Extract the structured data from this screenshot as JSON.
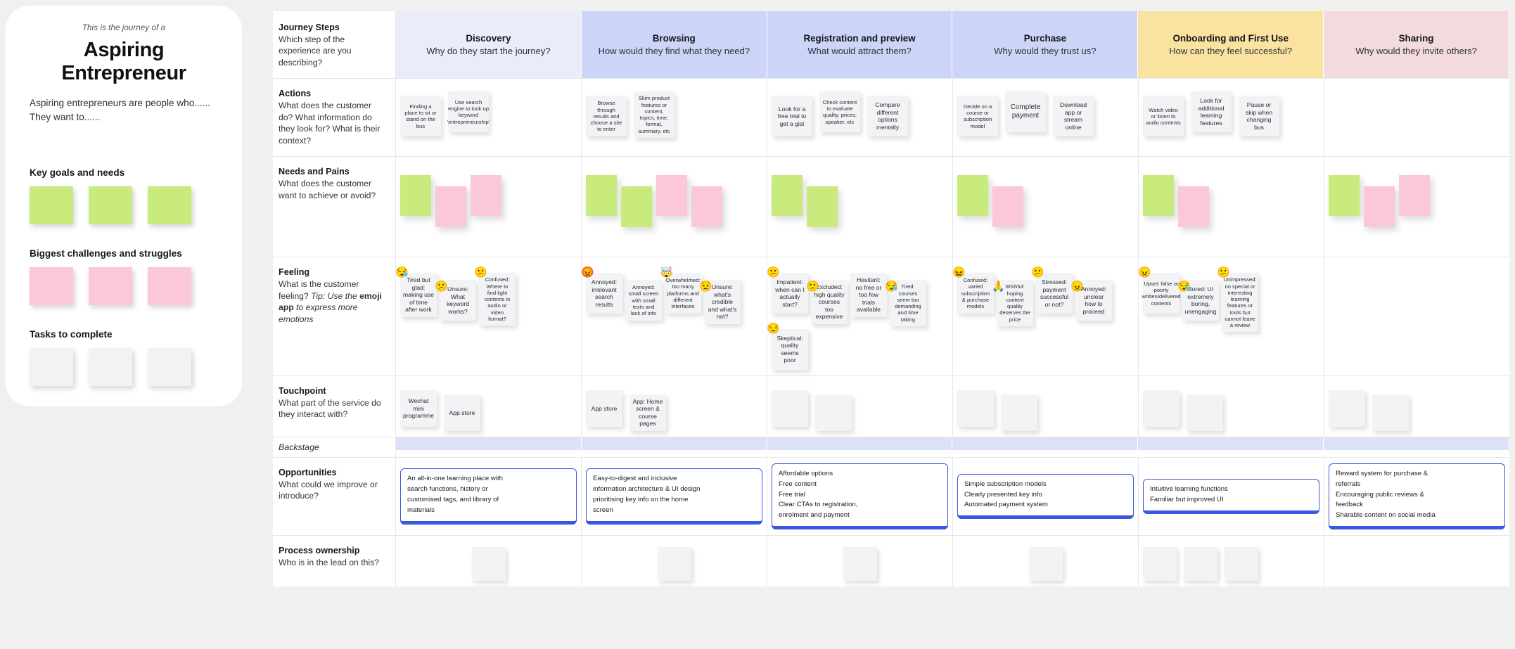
{
  "persona": {
    "kicker": "This is the journey of a",
    "title": "Aspiring Entrepreneur",
    "description": "Aspiring entrepreneurs are people who...... They want to......",
    "sections": [
      {
        "label": "Key goals and needs",
        "color": "green",
        "count": 3
      },
      {
        "label": "Biggest challenges and struggles",
        "color": "pink",
        "count": 3
      },
      {
        "label": "Tasks to complete",
        "color": "grey",
        "count": 3
      }
    ]
  },
  "rows": {
    "journey_steps": {
      "title": "Journey Steps",
      "desc": "Which step of the experience are you describing?"
    },
    "actions": {
      "title": "Actions",
      "desc": "What does the customer do? What information do they look for? What is their context?"
    },
    "needs": {
      "title": "Needs and Pains",
      "desc": "What does the customer want to achieve or avoid?"
    },
    "feeling": {
      "title": "Feeling",
      "desc_a": "What is the customer feeling? ",
      "tip_italic": "Tip: Use the ",
      "tip_bold": "emoji app",
      "tip_tail": " to express more emotions"
    },
    "touchpoint": {
      "title": "Touchpoint",
      "desc": "What part of the service do they interact with?"
    },
    "backstage": {
      "title": "Backstage"
    },
    "opportunities": {
      "title": "Opportunities",
      "desc": "What could we improve or introduce?"
    },
    "ownership": {
      "title": "Process ownership",
      "desc": "Who is in the lead on this?"
    }
  },
  "columns": [
    {
      "name": "Discovery",
      "question": "Why do they start the journey?",
      "color": "#eaecfa"
    },
    {
      "name": "Browsing",
      "question": "How would they find what they need?",
      "color": "#ccd4f7"
    },
    {
      "name": "Registration and preview",
      "question": "What would attract them?",
      "color": "#ccd4f7"
    },
    {
      "name": "Purchase",
      "question": "Why would they trust us?",
      "color": "#ccd4f7"
    },
    {
      "name": "Onboarding and First Use",
      "question": "How can they feel successful?",
      "color": "#fae2a0"
    },
    {
      "name": "Sharing",
      "question": "Why would they invite others?",
      "color": "#f3dade"
    }
  ],
  "actions": [
    [
      "Finding a place to sit or stand on the bus",
      "Use search engine to look up keyword 'entrepreneurship'"
    ],
    [
      "Browse through results and choose a site to enter",
      "Skim product features or content, topics, time, format, summary, etc"
    ],
    [
      "Look for a free trial to get a gist",
      "Check content to evaluate quality, prices, speaker, etc",
      "Compare different options mentally"
    ],
    [
      "Decide on a course or subscription model",
      "Complete payment",
      "Download app or stream online"
    ],
    [
      "Watch video or listen to audio contents",
      "Look for additional learning features",
      "Pause or skip when changing bus"
    ],
    []
  ],
  "needs": [
    [
      "green",
      "pink",
      "pink"
    ],
    [
      "green",
      "green",
      "pink",
      "pink"
    ],
    [
      "green",
      "green"
    ],
    [
      "green",
      "pink"
    ],
    [
      "green",
      "pink"
    ],
    [
      "green",
      "pink",
      "pink"
    ]
  ],
  "feelings": [
    [
      {
        "emoji": "😪",
        "text": "Tired but glad: making use of time after work"
      },
      {
        "emoji": "😕",
        "text": "Unsure: What keyword works?"
      },
      {
        "emoji": "😕",
        "text": "Confused: Where to find light contents in audio or video format?"
      }
    ],
    [
      {
        "emoji": "😡",
        "text": "Annoyed: irrelevant search results"
      },
      {
        "emoji": "",
        "text": "Annoyed: small screen with small texts and lack of info"
      },
      {
        "emoji": "🤯",
        "text": "Overwhelmed: too many platforms and different interfaces"
      },
      {
        "emoji": "😟",
        "text": "Unsure: what's credible and what's not?"
      }
    ],
    [
      {
        "emoji": "😕",
        "text": "Impatient: when can I actually start?"
      },
      {
        "emoji": "🙁",
        "text": "Excluded: high quality courses too expensive"
      },
      {
        "emoji": "",
        "text": "Hesitant: no free or too few trials available"
      },
      {
        "emoji": "😪",
        "text": "Tired: courses seem too demanding and time taking"
      },
      {
        "emoji": "😒",
        "text": "Skeptical: quality seems poor"
      }
    ],
    [
      {
        "emoji": "😖",
        "text": "Confused: varied subscription & purchase models"
      },
      {
        "emoji": "🙏",
        "text": "Wishful: hoping content quality deserves the price"
      },
      {
        "emoji": "😕",
        "text": "Stressed: payment successful or not?"
      },
      {
        "emoji": "😠",
        "text": "Annoyed: unclear how to proceed"
      }
    ],
    [
      {
        "emoji": "😠",
        "text": "Upset: false or poorly written/delivered contents"
      },
      {
        "emoji": "😪",
        "text": "Bored: UI extremely boring, unengaging"
      },
      {
        "emoji": "😕",
        "text": "Unimpressed: no special or interesting learning features or tools but cannot leave a review"
      }
    ],
    []
  ],
  "touchpoints": [
    [
      "Wechat mini programme",
      "App store"
    ],
    [
      "App store",
      "App: Home screen & course pages"
    ],
    [
      "",
      ""
    ],
    [
      "",
      ""
    ],
    [
      "",
      ""
    ],
    [
      "",
      ""
    ]
  ],
  "opportunities": [
    [
      "An all-in-one learning place with",
      "search functions, history or",
      "customised tags, and library of",
      "materials"
    ],
    [
      "Easy-to-digest and inclusive",
      "information architecture & UI design",
      "prioritising key info on the home",
      "screen"
    ],
    [
      "Affordable options",
      "Free content",
      "Free trial",
      "Clear CTAs to registration,",
      "enrolment and payment"
    ],
    [
      "Simple subscription models",
      "Clearly presented key info",
      "Automated payment system"
    ],
    [
      "Intuitive learning functions",
      "Familiar but improved UI"
    ],
    [
      "Reward system for purchase &",
      "referrals",
      "Encouraging public reviews &",
      "feedback",
      "Sharable content on social media"
    ]
  ],
  "ownership": [
    1,
    1,
    1,
    1,
    3,
    0
  ]
}
